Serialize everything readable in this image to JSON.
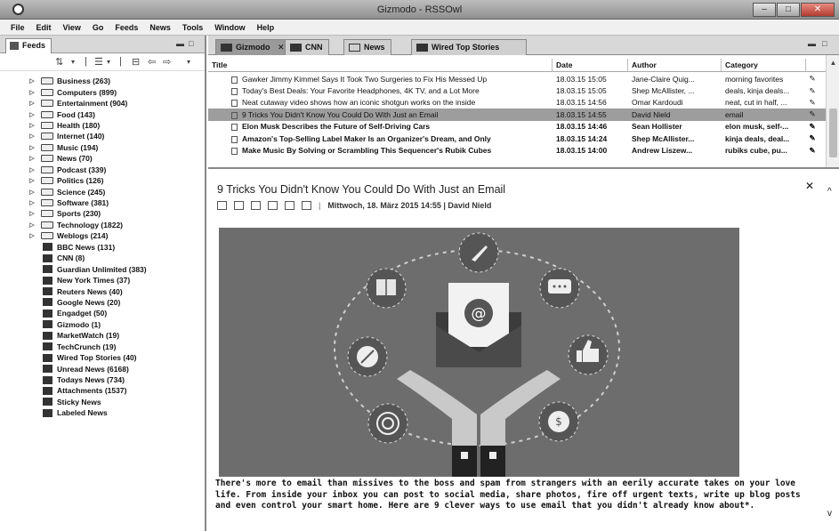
{
  "window": {
    "title": "Gizmodo - RSSOwl",
    "min": "–",
    "max": "□",
    "close": "✕"
  },
  "menu": [
    "File",
    "Edit",
    "View",
    "Go",
    "Feeds",
    "News",
    "Tools",
    "Window",
    "Help"
  ],
  "left_tab": {
    "label": "Feeds"
  },
  "tree": [
    {
      "kind": "folder",
      "label": "Business (263)"
    },
    {
      "kind": "folder",
      "label": "Computers (899)"
    },
    {
      "kind": "folder",
      "label": "Entertainment (904)"
    },
    {
      "kind": "folder",
      "label": "Food (143)"
    },
    {
      "kind": "folder",
      "label": "Health (180)"
    },
    {
      "kind": "folder",
      "label": "Internet (140)"
    },
    {
      "kind": "folder",
      "label": "Music (194)"
    },
    {
      "kind": "folder",
      "label": "News (70)"
    },
    {
      "kind": "folder",
      "label": "Podcast (339)"
    },
    {
      "kind": "folder",
      "label": "Politics (126)"
    },
    {
      "kind": "folder",
      "label": "Science (245)"
    },
    {
      "kind": "folder",
      "label": "Software (381)"
    },
    {
      "kind": "folder",
      "label": "Sports (230)"
    },
    {
      "kind": "folder",
      "label": "Technology (1822)"
    },
    {
      "kind": "folder",
      "label": "Weblogs (214)"
    },
    {
      "kind": "feed",
      "label": "BBC News (131)"
    },
    {
      "kind": "feed",
      "label": "CNN (8)"
    },
    {
      "kind": "feed",
      "label": "Guardian Unlimited (383)"
    },
    {
      "kind": "feed",
      "label": "New York Times (37)"
    },
    {
      "kind": "feed",
      "label": "Reuters News (40)"
    },
    {
      "kind": "feed",
      "label": "Google News (20)"
    },
    {
      "kind": "feed",
      "label": "Engadget (50)"
    },
    {
      "kind": "feed",
      "label": "Gizmodo (1)"
    },
    {
      "kind": "feed",
      "label": "MarketWatch (19)"
    },
    {
      "kind": "feed",
      "label": "TechCrunch (19)"
    },
    {
      "kind": "feed",
      "label": "Wired Top Stories (40)"
    },
    {
      "kind": "feed",
      "label": "Unread News (6168)"
    },
    {
      "kind": "feed",
      "label": "Todays News (734)"
    },
    {
      "kind": "feed",
      "label": "Attachments (1537)"
    },
    {
      "kind": "feed",
      "label": "Sticky News"
    },
    {
      "kind": "feed",
      "label": "Labeled News"
    }
  ],
  "right_tabs": [
    {
      "label": "Gizmodo",
      "active": true
    },
    {
      "label": "CNN",
      "active": false
    },
    {
      "label": "News",
      "active": false
    },
    {
      "label": "Wired Top Stories",
      "active": false
    }
  ],
  "headline_columns": [
    "Title",
    "Date",
    "Author",
    "Category"
  ],
  "headlines": [
    {
      "title": "Gawker Jimmy Kimmel Says It Took Two Surgeries to Fix His Messed Up",
      "date": "18.03.15 15:05",
      "author": "Jane-Claire Quig...",
      "category": "morning favorites",
      "bold": false,
      "selected": false
    },
    {
      "title": "Today's Best Deals: Your Favorite Headphones, 4K TV, and a Lot More",
      "date": "18.03.15 15:05",
      "author": "Shep McAllister, ...",
      "category": "deals, kinja deals...",
      "bold": false,
      "selected": false
    },
    {
      "title": "Neat cutaway video shows how an iconic shotgun works on the inside",
      "date": "18.03.15 14:56",
      "author": "Omar Kardoudi",
      "category": "neat, cut in half, ...",
      "bold": false,
      "selected": false
    },
    {
      "title": "9 Tricks You Didn't Know You Could Do With Just an Email",
      "date": "18.03.15 14:55",
      "author": "David Nield",
      "category": "email",
      "bold": false,
      "selected": true
    },
    {
      "title": "Elon Musk Describes the Future of Self-Driving Cars",
      "date": "18.03.15 14:46",
      "author": "Sean Hollister",
      "category": "elon musk, self-...",
      "bold": true,
      "selected": false
    },
    {
      "title": "Amazon's Top-Selling Label Maker Is an Organizer's Dream, and Only",
      "date": "18.03.15 14:24",
      "author": "Shep McAllister...",
      "category": "kinja deals, deal...",
      "bold": true,
      "selected": false
    },
    {
      "title": "Make Music By Solving or Scrambling This Sequencer's Rubik Cubes",
      "date": "18.03.15 14:00",
      "author": "Andrew Liszew...",
      "category": "rubiks cube, pu...",
      "bold": true,
      "selected": false
    }
  ],
  "article": {
    "title": "9 Tricks You Didn't Know You Could Do With Just an Email",
    "meta": "Mittwoch, 18. März 2015 14:55 | David Nield",
    "hero_at": "@",
    "body": "There's more to email than missives to the boss and spam from strangers with an eerily accurate takes on your love life. From inside your inbox you can post to social media, share photos, fire off urgent texts, write up blog posts and even control your smart home. Here are 9 clever ways to use email that you didn't already know about*."
  }
}
